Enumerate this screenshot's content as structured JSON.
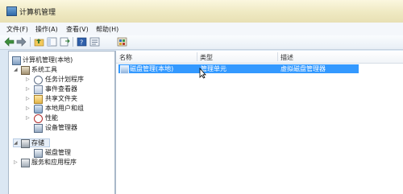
{
  "window": {
    "title": "计算机管理"
  },
  "menu": [
    {
      "label": "文件(F)"
    },
    {
      "label": "操作(A)"
    },
    {
      "label": "查看(V)"
    },
    {
      "label": "帮助(H)"
    }
  ],
  "toolbar": {
    "buttons": [
      "back-arrow-icon",
      "forward-arrow-icon",
      "up-folder-icon",
      "show-hide-tree-icon",
      "export-list-icon",
      "help-icon",
      "properties-icon",
      "snapin-icon"
    ]
  },
  "tree": {
    "root": "计算机管理(本地)",
    "system_tools": "系统工具",
    "task_scheduler": "任务计划程序",
    "event_viewer": "事件查看器",
    "shared_folders": "共享文件夹",
    "local_users": "本地用户和组",
    "performance": "性能",
    "device_manager": "设备管理器",
    "storage": "存储",
    "disk_management": "磁盘管理",
    "services_apps": "服务和应用程序"
  },
  "list": {
    "columns": {
      "name": "名称",
      "type": "类型",
      "description": "描述"
    },
    "rows": [
      {
        "name": "磁盘管理(本地)",
        "type": "管理单元",
        "description": "虚拟磁盘管理器",
        "selected": true
      }
    ]
  },
  "colors": {
    "selection": "#3399ff",
    "titlebar": "#f3eecf"
  }
}
